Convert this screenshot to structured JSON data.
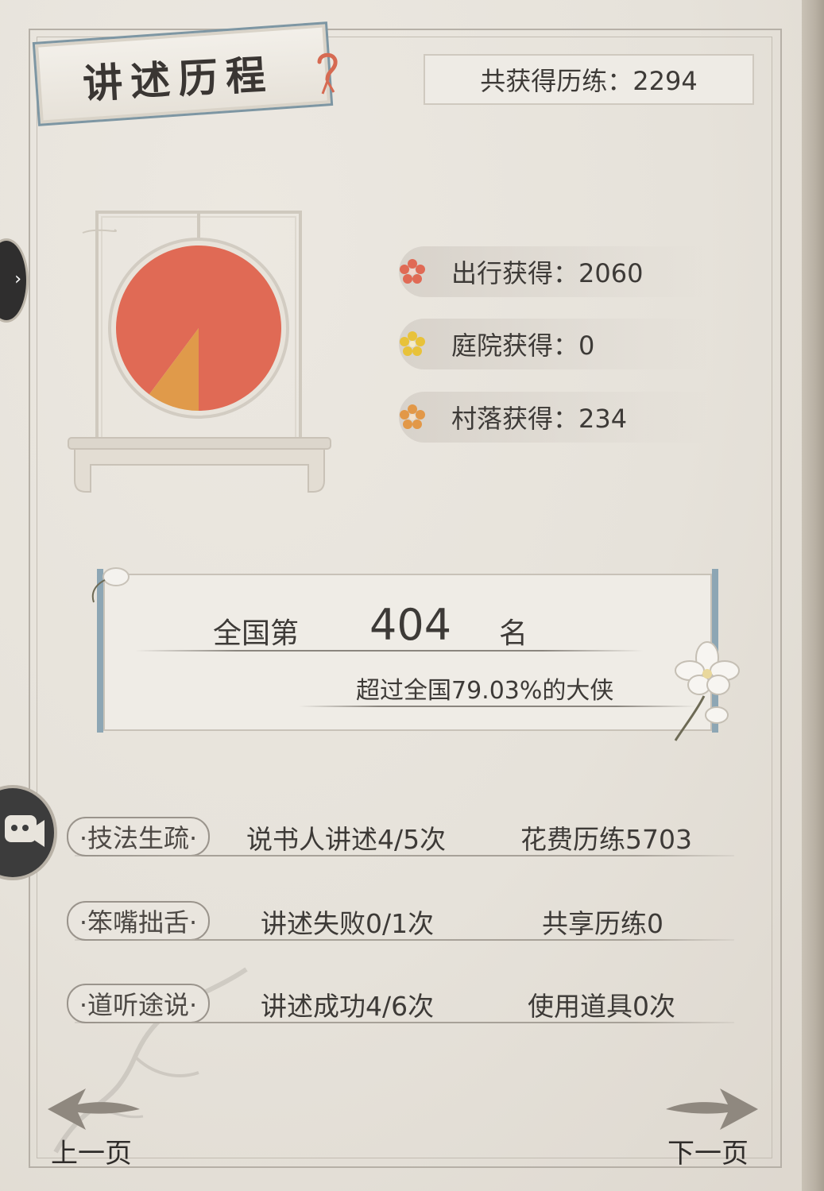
{
  "header": {
    "title": "讲述历程",
    "help_icon": "question-mark-icon",
    "total_label": "共获得历练：2294"
  },
  "breakdown": {
    "items": [
      {
        "label": "出行获得：2060",
        "icon": "red-flower-icon",
        "color": "#e06a55"
      },
      {
        "label": "庭院获得：0",
        "icon": "yellow-flower-icon",
        "color": "#e8c23a"
      },
      {
        "label": "村落获得：234",
        "icon": "orange-flower-icon",
        "color": "#e29848"
      }
    ]
  },
  "chart_data": {
    "type": "pie",
    "categories": [
      "出行获得",
      "庭院获得",
      "村落获得"
    ],
    "values": [
      2060,
      0,
      234
    ],
    "colors": [
      "#e06a55",
      "#e8c23a",
      "#e09a4a"
    ]
  },
  "rank": {
    "prefix": "全国第",
    "number": "404",
    "suffix": "名",
    "subtitle": "超过全国79.03%的大侠"
  },
  "stats_rows": [
    {
      "tag": "·技法生疏·",
      "col2": "说书人讲述4/5次",
      "col3": "花费历练5703"
    },
    {
      "tag": "·笨嘴拙舌·",
      "col2": "讲述失败0/1次",
      "col3": "共享历练0"
    },
    {
      "tag": "·道听途说·",
      "col2": "讲述成功4/6次",
      "col3": "使用道具0次"
    }
  ],
  "footer": {
    "prev_label": "上一页",
    "next_label": "下一页",
    "prev_icon": "arrow-left-icon",
    "next_icon": "arrow-right-icon"
  },
  "side": {
    "nav_icon": "chevron-right-icon",
    "chat_icon": "chat-bubble-icon"
  }
}
